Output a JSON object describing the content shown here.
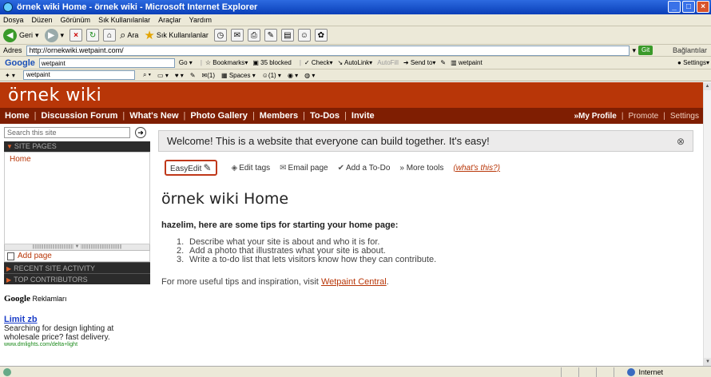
{
  "window": {
    "title": "örnek wiki Home - örnek wiki - Microsoft Internet Explorer"
  },
  "menu": [
    "Dosya",
    "Düzen",
    "Görünüm",
    "Sık Kullanılanlar",
    "Araçlar",
    "Yardım"
  ],
  "toolbar": {
    "back": "Geri",
    "search": "Ara",
    "favorites": "Sık Kullanılanlar"
  },
  "address": {
    "label": "Adres",
    "url": "http://ornekwiki.wetpaint.com/",
    "go": "Git",
    "links": "Bağlantılar"
  },
  "google_toolbar": {
    "logo": "Google",
    "query": "wetpaint",
    "go": "Go",
    "bookmarks": "Bookmarks",
    "blocked": "35 blocked",
    "check": "Check",
    "autolink": "AutoLink",
    "autofill": "AutoFill",
    "sendto": "Send to",
    "wetpaint": "wetpaint",
    "settings": "Settings"
  },
  "wet_toolbar": {
    "query": "wetpaint",
    "count1": "(1)",
    "spaces": "Spaces",
    "count2": "(1)"
  },
  "site": {
    "logo": "örnek wiki",
    "nav": [
      "Home",
      "Discussion Forum",
      "What's New",
      "Photo Gallery",
      "Members",
      "To-Dos",
      "Invite"
    ],
    "my_profile": "»My Profile",
    "promote": "Promote",
    "settings": "Settings"
  },
  "sidebar": {
    "search_placeholder": "Search this site",
    "site_pages": "SITE PAGES",
    "pages": [
      "Home"
    ],
    "add_page": "Add page",
    "recent_activity": "RECENT SITE ACTIVITY",
    "top_contributors": "TOP CONTRIBUTORS",
    "ads_label": "Google",
    "ads_suffix": "Reklamları",
    "ad": {
      "title": "Limit zb",
      "text": "Searching for design lighting at wholesale price? fast delivery.",
      "url": "www.dmlights.com/delta+light"
    }
  },
  "main": {
    "welcome": "Welcome! This is a website that everyone can build together. It's easy!",
    "easyedit": "EasyEdit",
    "edit_tags": "Edit tags",
    "email_page": "Email page",
    "add_todo": "Add a To-Do",
    "more_tools": "» More tools",
    "whats_this": "(what's this?)",
    "page_title": "örnek wiki Home",
    "tips_head": "hazelim, here are some tips for starting your home page:",
    "tips": [
      "Describe what your site is about and who it is for.",
      "Add a photo that illustrates what your site is about.",
      "Write a to-do list that lets visitors know how they can contribute."
    ],
    "more_prefix": "For more useful tips and inspiration, visit",
    "more_link": "Wetpaint Central",
    "more_suffix": "."
  },
  "status": {
    "zone": "Internet"
  }
}
